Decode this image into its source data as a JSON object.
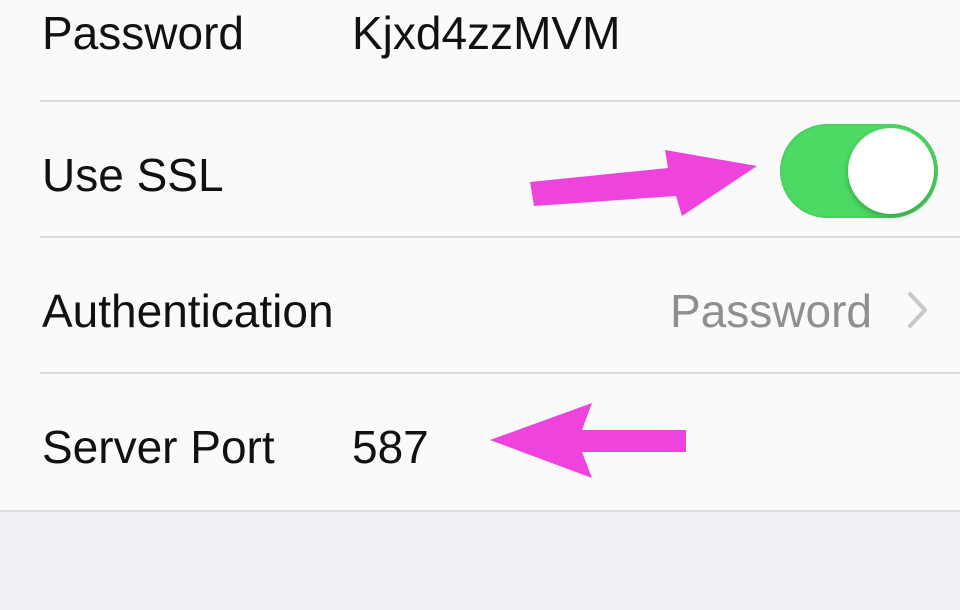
{
  "theme": {
    "toggle_on_color": "#4cd964",
    "annotation_color": "#ee44dd"
  },
  "settings": {
    "password": {
      "label": "Password",
      "value": "Kjxd4zzMVM"
    },
    "use_ssl": {
      "label": "Use SSL",
      "state": "on"
    },
    "authentication": {
      "label": "Authentication",
      "value": "Password",
      "accessory": "chevron-right-icon"
    },
    "server_port": {
      "label": "Server Port",
      "value": "587"
    }
  },
  "annotations": [
    {
      "name": "arrow-to-ssl-toggle",
      "direction": "right",
      "icon": "arrow-right-icon"
    },
    {
      "name": "arrow-to-server-port",
      "direction": "left",
      "icon": "arrow-left-icon"
    }
  ]
}
